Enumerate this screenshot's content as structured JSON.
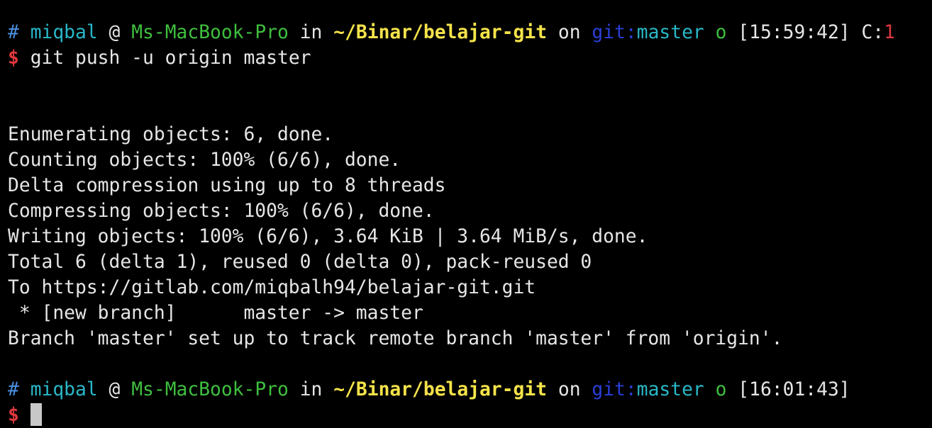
{
  "prompt1": {
    "hash": "#",
    "user": "miqbal",
    "at": "@",
    "host": "Ms-MacBook-Pro",
    "in": "in",
    "path": "~/Binar/belajar-git",
    "on": "on",
    "git_label": "git:",
    "branch": "master",
    "clean_marker": "o",
    "time": "[15:59:42]",
    "exit_label": "C:",
    "exit_code": "1"
  },
  "command1": {
    "dollar": "$",
    "text": "git push -u origin master"
  },
  "output": [
    "Enumerating objects: 6, done.",
    "Counting objects: 100% (6/6), done.",
    "Delta compression using up to 8 threads",
    "Compressing objects: 100% (6/6), done.",
    "Writing objects: 100% (6/6), 3.64 KiB | 3.64 MiB/s, done.",
    "Total 6 (delta 1), reused 0 (delta 0), pack-reused 0",
    "To https://gitlab.com/miqbalh94/belajar-git.git",
    " * [new branch]      master -> master",
    "Branch 'master' set up to track remote branch 'master' from 'origin'."
  ],
  "prompt2": {
    "hash": "#",
    "user": "miqbal",
    "at": "@",
    "host": "Ms-MacBook-Pro",
    "in": "in",
    "path": "~/Binar/belajar-git",
    "on": "on",
    "git_label": "git:",
    "branch": "master",
    "clean_marker": "o",
    "time": "[16:01:43]"
  },
  "command2": {
    "dollar": "$"
  },
  "colors": {
    "background": "#000000",
    "text": "#e6e6e6",
    "user": "#29b8c8",
    "host": "#3fbf3f",
    "path": "#f5e34a",
    "git": "#2a3fd6",
    "error": "#e0383e"
  }
}
